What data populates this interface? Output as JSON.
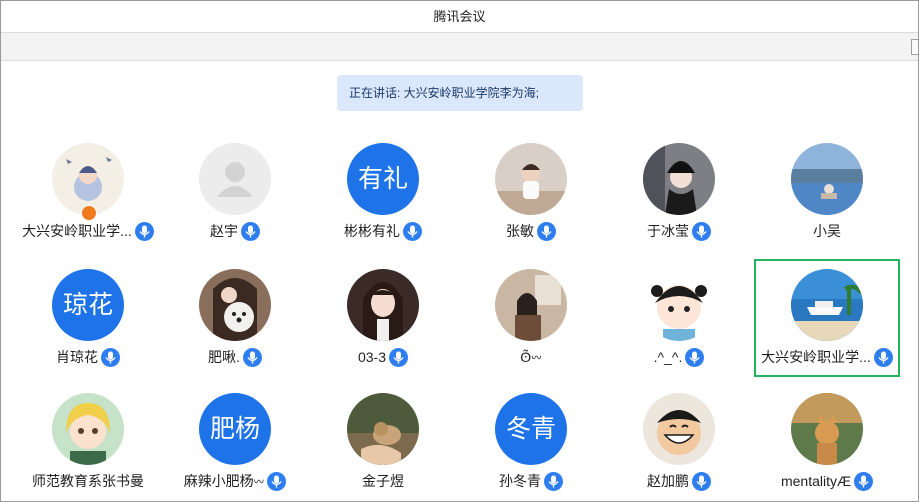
{
  "window": {
    "title": "腾讯会议"
  },
  "banner": {
    "text": "正在讲话: 大兴安岭职业学院李为海;"
  },
  "colors": {
    "accent": "#1e73e8",
    "active_border": "#22b35e",
    "banner_bg": "#dbe7fb"
  },
  "participants": [
    {
      "name": "大兴安岭职业学...",
      "avatar": "photo-anime-girl",
      "avatar_text": "",
      "mic": true,
      "host_badge": true,
      "active": false
    },
    {
      "name": "赵宇",
      "avatar": "placeholder-person",
      "avatar_text": "",
      "mic": true,
      "host_badge": false,
      "active": false
    },
    {
      "name": "彬彬有礼",
      "avatar": "text",
      "avatar_text": "有礼",
      "mic": true,
      "host_badge": false,
      "active": false
    },
    {
      "name": "张敏",
      "avatar": "photo-child",
      "avatar_text": "",
      "mic": true,
      "host_badge": false,
      "active": false
    },
    {
      "name": "于冰莹",
      "avatar": "photo-girl-hat",
      "avatar_text": "",
      "mic": true,
      "host_badge": false,
      "active": false
    },
    {
      "name": "小吴",
      "avatar": "photo-lake",
      "avatar_text": "",
      "mic": false,
      "host_badge": false,
      "active": false
    },
    {
      "name": "肖琼花",
      "avatar": "text",
      "avatar_text": "琼花",
      "mic": true,
      "host_badge": false,
      "active": false
    },
    {
      "name": "肥啾.",
      "avatar": "photo-girl-dog",
      "avatar_text": "",
      "mic": true,
      "host_badge": false,
      "active": false
    },
    {
      "name": "03-3",
      "avatar": "photo-girl-portrait",
      "avatar_text": "",
      "mic": true,
      "host_badge": false,
      "active": false
    },
    {
      "name": "ʘ̃𖥦",
      "avatar": "photo-girl-room",
      "avatar_text": "",
      "mic": false,
      "host_badge": false,
      "active": false
    },
    {
      "name": ".^_^.",
      "avatar": "cartoon-girl",
      "avatar_text": "",
      "mic": true,
      "host_badge": false,
      "active": false
    },
    {
      "name": "大兴安岭职业学...",
      "avatar": "photo-cruise-ship",
      "avatar_text": "",
      "mic": true,
      "host_badge": false,
      "active": true
    },
    {
      "name": "师范教育系张书曼",
      "avatar": "cartoon-blonde-girl",
      "avatar_text": "",
      "mic": false,
      "host_badge": false,
      "active": false
    },
    {
      "name": "麻辣小肥杨𖥦",
      "avatar": "text",
      "avatar_text": "肥杨",
      "mic": true,
      "host_badge": false,
      "active": false
    },
    {
      "name": "金子煜",
      "avatar": "photo-cat-hand",
      "avatar_text": "",
      "mic": false,
      "host_badge": false,
      "active": false
    },
    {
      "name": "孙冬青",
      "avatar": "text",
      "avatar_text": "冬青",
      "mic": true,
      "host_badge": false,
      "active": false
    },
    {
      "name": "赵加鹏",
      "avatar": "cartoon-luffy",
      "avatar_text": "",
      "mic": true,
      "host_badge": false,
      "active": false
    },
    {
      "name": "mentalityÆ",
      "avatar": "photo-cat-garden",
      "avatar_text": "",
      "mic": true,
      "host_badge": false,
      "active": false
    }
  ]
}
